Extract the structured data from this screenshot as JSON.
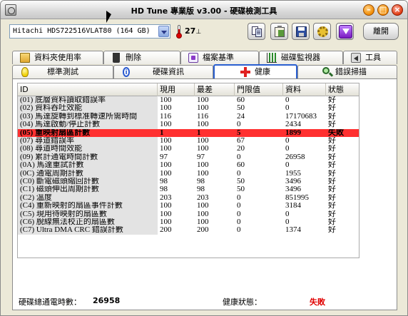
{
  "window": {
    "title": "HD Tune 專業版 v3.00 - 硬碟檢測工具"
  },
  "toolbar": {
    "drive": "Hitachi HDS722516VLAT80 (164 GB)",
    "temperature": "27",
    "temperature_unit": "⊥",
    "exit_label": "離開"
  },
  "tabs_top": [
    {
      "label": "資料夾使用率",
      "icon": "folder-icon"
    },
    {
      "label": "刪除",
      "icon": "trash-icon"
    },
    {
      "label": "檔案基準",
      "icon": "file-benchmark-icon"
    },
    {
      "label": "磁碟監視器",
      "icon": "disk-monitor-icon"
    },
    {
      "label": "工具",
      "icon": "speaker-icon"
    }
  ],
  "tabs_bottom": [
    {
      "label": "標準測試",
      "icon": "bulb-icon"
    },
    {
      "label": "硬碟資訊",
      "icon": "info-icon"
    },
    {
      "label": "健康",
      "icon": "health-cross-icon",
      "active": true
    },
    {
      "label": "錯誤掃描",
      "icon": "scan-icon"
    }
  ],
  "table": {
    "headers": [
      "ID",
      "現用",
      "最差",
      "門限值",
      "資料",
      "狀態"
    ],
    "rows": [
      {
        "id": "(01) 底層資料讀取錯誤率",
        "current": "100",
        "worst": "100",
        "threshold": "60",
        "data": "0",
        "status": "好"
      },
      {
        "id": "(02) 資料吞吐效能",
        "current": "100",
        "worst": "100",
        "threshold": "50",
        "data": "0",
        "status": "好"
      },
      {
        "id": "(03) 馬達旋轉到標准轉速所需時間",
        "current": "116",
        "worst": "116",
        "threshold": "24",
        "data": "17170683",
        "status": "好"
      },
      {
        "id": "(04) 馬達啟動/停止計數",
        "current": "100",
        "worst": "100",
        "threshold": "0",
        "data": "2434",
        "status": "好"
      },
      {
        "id": "(05) 重映射扇區計數",
        "current": "1",
        "worst": "1",
        "threshold": "5",
        "data": "1899",
        "status": "失敗",
        "fail": true
      },
      {
        "id": "(07) 尋道錯誤率",
        "current": "100",
        "worst": "100",
        "threshold": "67",
        "data": "0",
        "status": "好"
      },
      {
        "id": "(08) 尋道時間效能",
        "current": "100",
        "worst": "100",
        "threshold": "20",
        "data": "0",
        "status": "好"
      },
      {
        "id": "(09) 累計通電時間計數",
        "current": "97",
        "worst": "97",
        "threshold": "0",
        "data": "26958",
        "status": "好"
      },
      {
        "id": "(0A) 馬達重試計數",
        "current": "100",
        "worst": "100",
        "threshold": "60",
        "data": "0",
        "status": "好"
      },
      {
        "id": "(0C) 通電周期計數",
        "current": "100",
        "worst": "100",
        "threshold": "0",
        "data": "1955",
        "status": "好"
      },
      {
        "id": "(C0) 斷電磁頭縮回計數",
        "current": "98",
        "worst": "98",
        "threshold": "50",
        "data": "3496",
        "status": "好"
      },
      {
        "id": "(C1) 磁頭伸出周期計數",
        "current": "98",
        "worst": "98",
        "threshold": "50",
        "data": "3496",
        "status": "好"
      },
      {
        "id": "(C2) 溫度",
        "current": "203",
        "worst": "203",
        "threshold": "0",
        "data": "851995",
        "status": "好"
      },
      {
        "id": "(C4) 重新映射的扇區事件計數",
        "current": "100",
        "worst": "100",
        "threshold": "0",
        "data": "3184",
        "status": "好"
      },
      {
        "id": "(C5) 現用待映射的扇區數",
        "current": "100",
        "worst": "100",
        "threshold": "0",
        "data": "0",
        "status": "好"
      },
      {
        "id": "(C6) 脫線無法校正的扇區數",
        "current": "100",
        "worst": "100",
        "threshold": "0",
        "data": "0",
        "status": "好"
      },
      {
        "id": "(C7) Ultra DMA CRC 錯誤計數",
        "current": "200",
        "worst": "200",
        "threshold": "0",
        "data": "1374",
        "status": "好"
      }
    ]
  },
  "status": {
    "power_on_label": "硬碟總通電時數：",
    "power_on_value": "26958",
    "health_label": "健康狀態：",
    "health_value": "失敗"
  },
  "colors": {
    "fail_row": "#ff3030",
    "fail_text": "#e00000",
    "active_tab_border": "#2a5fd0"
  }
}
